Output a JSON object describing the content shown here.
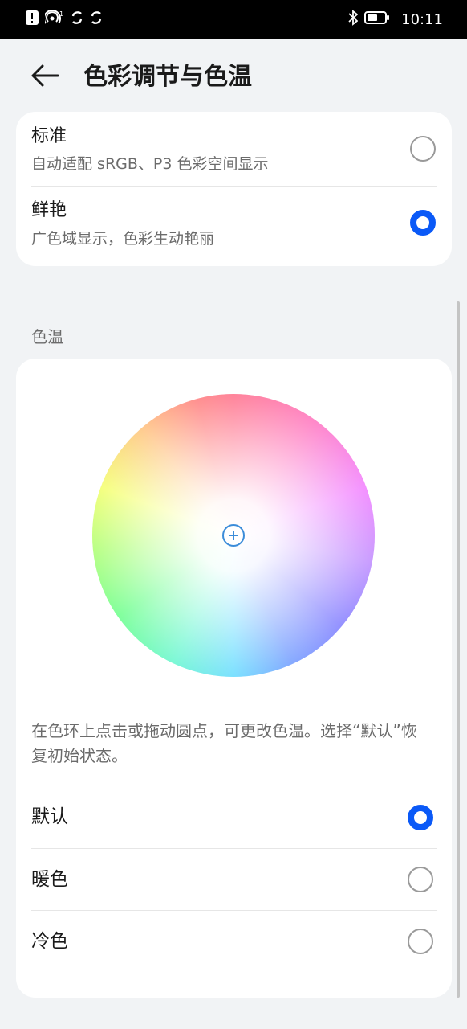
{
  "status_bar": {
    "time": "10:11",
    "left_icons": [
      "notification-badge-icon",
      "nfc-signal-icon",
      "sync-icon",
      "sync-icon"
    ],
    "right_icons": [
      "bluetooth-icon",
      "battery-icon"
    ]
  },
  "header": {
    "title": "色彩调节与色温"
  },
  "color_mode": {
    "options": [
      {
        "title": "标准",
        "subtitle": "自动适配 sRGB、P3 色彩空间显示",
        "selected": false
      },
      {
        "title": "鲜艳",
        "subtitle": "广色域显示，色彩生动艳丽",
        "selected": true
      }
    ]
  },
  "color_temperature": {
    "section_label": "色温",
    "hint": "在色环上点击或拖动圆点，可更改色温。选择“默认”恢复初始状态。",
    "options": [
      {
        "label": "默认",
        "selected": true
      },
      {
        "label": "暖色",
        "selected": false
      },
      {
        "label": "冷色",
        "selected": false
      }
    ]
  },
  "colors": {
    "accent": "#0a59f7",
    "background": "#f1f3f5",
    "card": "#ffffff",
    "handle": "#3b8cd9"
  }
}
